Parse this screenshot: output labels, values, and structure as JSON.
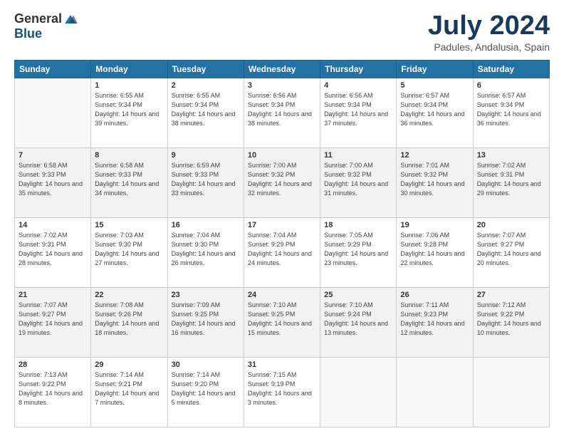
{
  "logo": {
    "general": "General",
    "blue": "Blue"
  },
  "title": "July 2024",
  "location": "Padules, Andalusia, Spain",
  "days_of_week": [
    "Sunday",
    "Monday",
    "Tuesday",
    "Wednesday",
    "Thursday",
    "Friday",
    "Saturday"
  ],
  "weeks": [
    [
      {
        "day": "",
        "info": ""
      },
      {
        "day": "1",
        "info": "Sunrise: 6:55 AM\nSunset: 9:34 PM\nDaylight: 14 hours\nand 39 minutes."
      },
      {
        "day": "2",
        "info": "Sunrise: 6:55 AM\nSunset: 9:34 PM\nDaylight: 14 hours\nand 38 minutes."
      },
      {
        "day": "3",
        "info": "Sunrise: 6:56 AM\nSunset: 9:34 PM\nDaylight: 14 hours\nand 38 minutes."
      },
      {
        "day": "4",
        "info": "Sunrise: 6:56 AM\nSunset: 9:34 PM\nDaylight: 14 hours\nand 37 minutes."
      },
      {
        "day": "5",
        "info": "Sunrise: 6:57 AM\nSunset: 9:34 PM\nDaylight: 14 hours\nand 36 minutes."
      },
      {
        "day": "6",
        "info": "Sunrise: 6:57 AM\nSunset: 9:34 PM\nDaylight: 14 hours\nand 36 minutes."
      }
    ],
    [
      {
        "day": "7",
        "info": "Sunrise: 6:58 AM\nSunset: 9:33 PM\nDaylight: 14 hours\nand 35 minutes."
      },
      {
        "day": "8",
        "info": "Sunrise: 6:58 AM\nSunset: 9:33 PM\nDaylight: 14 hours\nand 34 minutes."
      },
      {
        "day": "9",
        "info": "Sunrise: 6:59 AM\nSunset: 9:33 PM\nDaylight: 14 hours\nand 33 minutes."
      },
      {
        "day": "10",
        "info": "Sunrise: 7:00 AM\nSunset: 9:32 PM\nDaylight: 14 hours\nand 32 minutes."
      },
      {
        "day": "11",
        "info": "Sunrise: 7:00 AM\nSunset: 9:32 PM\nDaylight: 14 hours\nand 31 minutes."
      },
      {
        "day": "12",
        "info": "Sunrise: 7:01 AM\nSunset: 9:32 PM\nDaylight: 14 hours\nand 30 minutes."
      },
      {
        "day": "13",
        "info": "Sunrise: 7:02 AM\nSunset: 9:31 PM\nDaylight: 14 hours\nand 29 minutes."
      }
    ],
    [
      {
        "day": "14",
        "info": "Sunrise: 7:02 AM\nSunset: 9:31 PM\nDaylight: 14 hours\nand 28 minutes."
      },
      {
        "day": "15",
        "info": "Sunrise: 7:03 AM\nSunset: 9:30 PM\nDaylight: 14 hours\nand 27 minutes."
      },
      {
        "day": "16",
        "info": "Sunrise: 7:04 AM\nSunset: 9:30 PM\nDaylight: 14 hours\nand 26 minutes."
      },
      {
        "day": "17",
        "info": "Sunrise: 7:04 AM\nSunset: 9:29 PM\nDaylight: 14 hours\nand 24 minutes."
      },
      {
        "day": "18",
        "info": "Sunrise: 7:05 AM\nSunset: 9:29 PM\nDaylight: 14 hours\nand 23 minutes."
      },
      {
        "day": "19",
        "info": "Sunrise: 7:06 AM\nSunset: 9:28 PM\nDaylight: 14 hours\nand 22 minutes."
      },
      {
        "day": "20",
        "info": "Sunrise: 7:07 AM\nSunset: 9:27 PM\nDaylight: 14 hours\nand 20 minutes."
      }
    ],
    [
      {
        "day": "21",
        "info": "Sunrise: 7:07 AM\nSunset: 9:27 PM\nDaylight: 14 hours\nand 19 minutes."
      },
      {
        "day": "22",
        "info": "Sunrise: 7:08 AM\nSunset: 9:26 PM\nDaylight: 14 hours\nand 18 minutes."
      },
      {
        "day": "23",
        "info": "Sunrise: 7:09 AM\nSunset: 9:25 PM\nDaylight: 14 hours\nand 16 minutes."
      },
      {
        "day": "24",
        "info": "Sunrise: 7:10 AM\nSunset: 9:25 PM\nDaylight: 14 hours\nand 15 minutes."
      },
      {
        "day": "25",
        "info": "Sunrise: 7:10 AM\nSunset: 9:24 PM\nDaylight: 14 hours\nand 13 minutes."
      },
      {
        "day": "26",
        "info": "Sunrise: 7:11 AM\nSunset: 9:23 PM\nDaylight: 14 hours\nand 12 minutes."
      },
      {
        "day": "27",
        "info": "Sunrise: 7:12 AM\nSunset: 9:22 PM\nDaylight: 14 hours\nand 10 minutes."
      }
    ],
    [
      {
        "day": "28",
        "info": "Sunrise: 7:13 AM\nSunset: 9:22 PM\nDaylight: 14 hours\nand 8 minutes."
      },
      {
        "day": "29",
        "info": "Sunrise: 7:14 AM\nSunset: 9:21 PM\nDaylight: 14 hours\nand 7 minutes."
      },
      {
        "day": "30",
        "info": "Sunrise: 7:14 AM\nSunset: 9:20 PM\nDaylight: 14 hours\nand 5 minutes."
      },
      {
        "day": "31",
        "info": "Sunrise: 7:15 AM\nSunset: 9:19 PM\nDaylight: 14 hours\nand 3 minutes."
      },
      {
        "day": "",
        "info": ""
      },
      {
        "day": "",
        "info": ""
      },
      {
        "day": "",
        "info": ""
      }
    ]
  ]
}
